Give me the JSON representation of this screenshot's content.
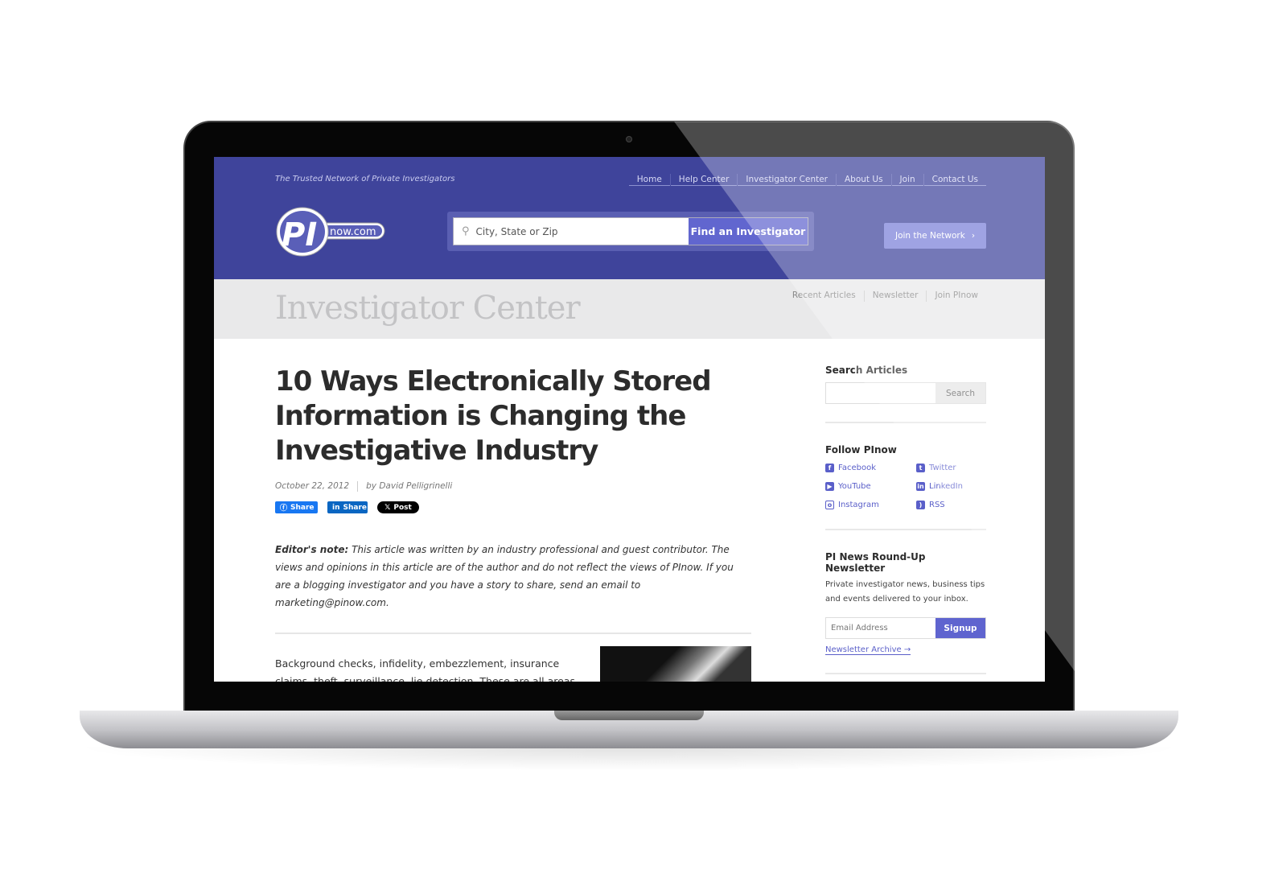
{
  "colors": {
    "header": "#3f449b",
    "accent": "#6166cf",
    "subbar": "#e9e9ea"
  },
  "header": {
    "tagline": "The Trusted Network of Private Investigators",
    "nav": [
      "Home",
      "Help Center",
      "Investigator Center",
      "About Us",
      "Join",
      "Contact Us"
    ],
    "logo_text": "PI now.com",
    "search_placeholder": "City, State or Zip",
    "search_button": "Find an Investigator",
    "join_button": "Join the Network",
    "join_icon": "chevron-right-icon"
  },
  "subbar": {
    "title": "Investigator Center",
    "nav": [
      "Recent Articles",
      "Newsletter",
      "Join PInow"
    ]
  },
  "article": {
    "title": "10 Ways Electronically Stored Information is Changing the Investigative Industry",
    "date": "October 22, 2012",
    "author": "by David Pelligrinelli",
    "share": {
      "facebook": "Share",
      "linkedin": "Share",
      "x": "Post"
    },
    "note_label": "Editor's note:",
    "note_text": " This article was written by an industry professional and guest contributor. The views and opinions in this article are of the author and do not reflect the views of PInow. If you are a blogging investigator and you have a story to share, send an email to marketing@pinow.com.",
    "body": "Background checks, infidelity, embezzlement, insurance claims, theft, surveillance, lie detection. These are all areas of professional services traditionally associated with private"
  },
  "sidebar": {
    "search_title": "Search Articles",
    "search_button": "Search",
    "follow_title": "Follow PInow",
    "social": [
      {
        "label": "Facebook",
        "icon": "facebook-icon"
      },
      {
        "label": "Twitter",
        "icon": "twitter-icon"
      },
      {
        "label": "YouTube",
        "icon": "youtube-icon"
      },
      {
        "label": "LinkedIn",
        "icon": "linkedin-icon"
      },
      {
        "label": "Instagram",
        "icon": "instagram-icon"
      },
      {
        "label": "RSS",
        "icon": "rss-icon"
      }
    ],
    "newsletter_title": "PI News Round-Up Newsletter",
    "newsletter_desc": "Private investigator news, business tips and events delivered to your inbox.",
    "email_placeholder": "Email Address",
    "signup": "Signup",
    "archive": "Newsletter Archive →"
  }
}
